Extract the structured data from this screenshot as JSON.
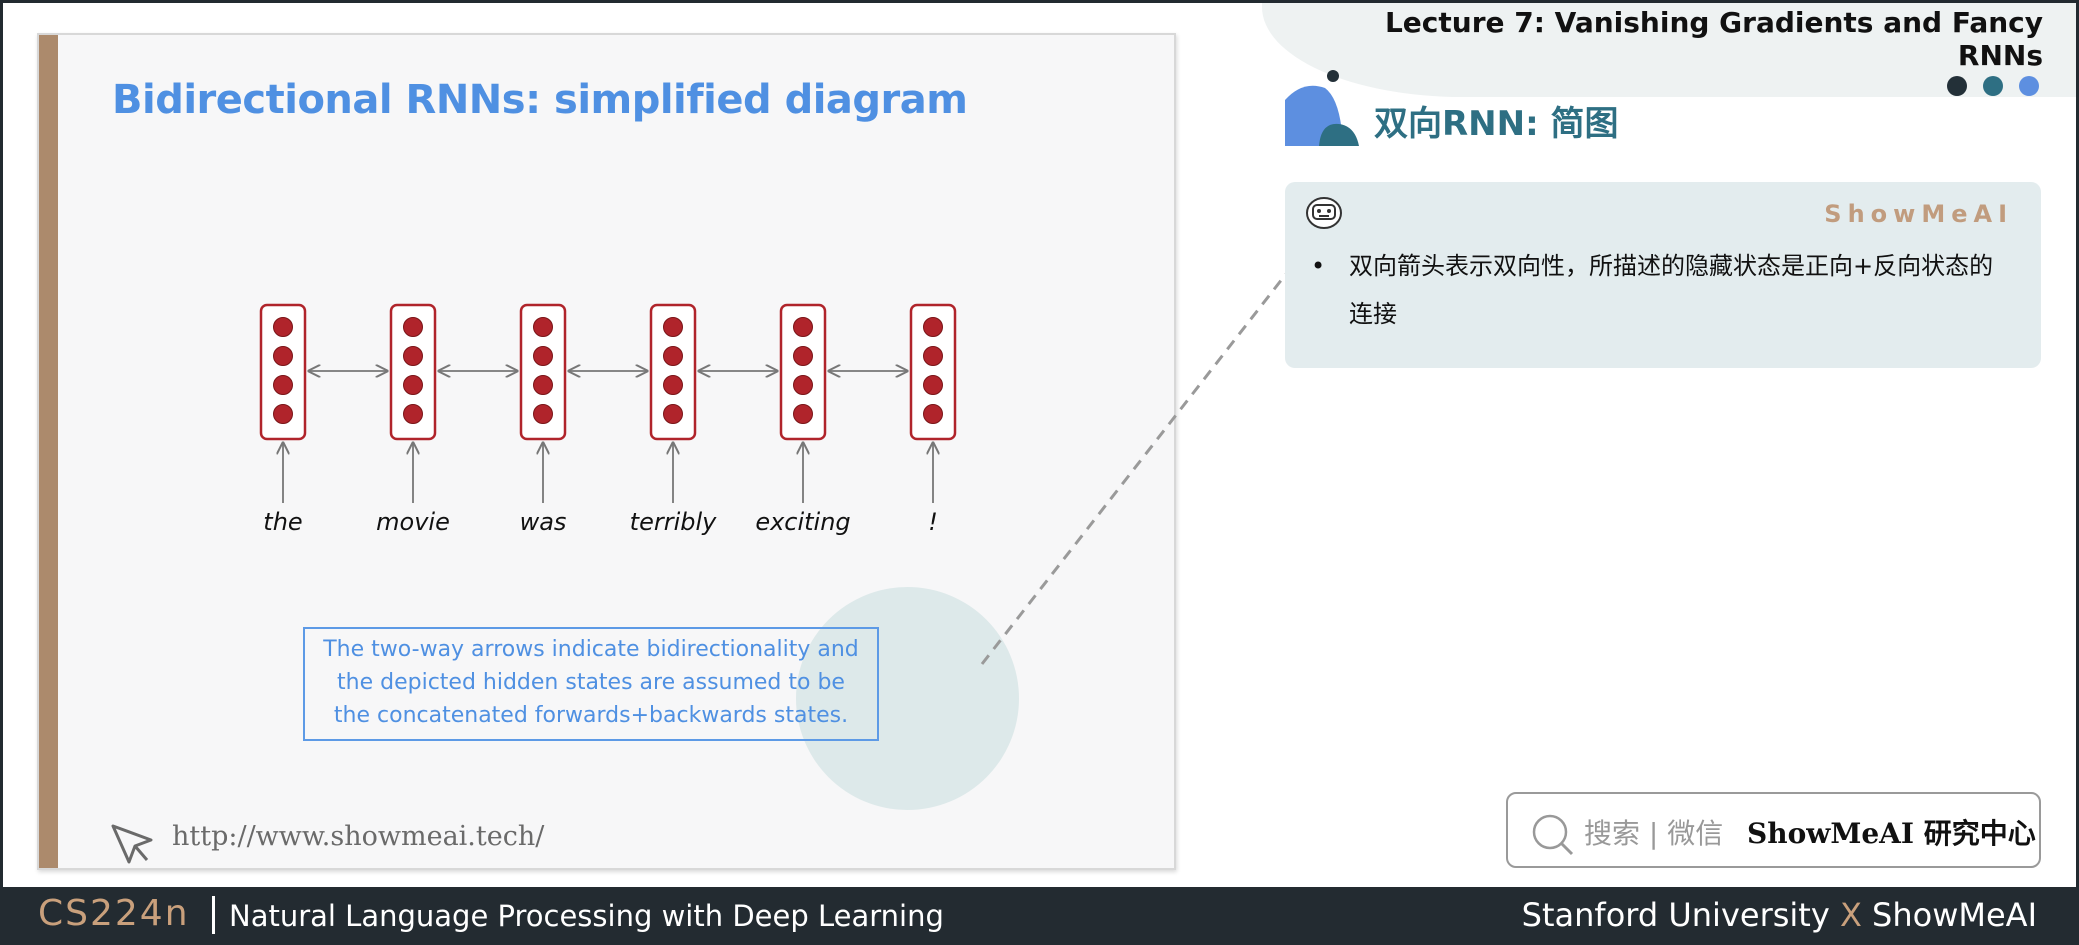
{
  "slide": {
    "title": "Bidirectional RNNs: simplified diagram",
    "words": [
      "the",
      "movie",
      "was",
      "terribly",
      "exciting",
      "!"
    ],
    "caption": [
      "The two-way arrows indicate bidirectionality and",
      "the depicted hidden states are assumed to be",
      "the concatenated forwards+backwards states."
    ],
    "url": "http://www.showmeai.tech/"
  },
  "header": {
    "lecture_title": "Lecture 7:  Vanishing Gradients and Fancy RNNs",
    "section_title": "双向RNN: 简图"
  },
  "note": {
    "brand": "ShowMeAI",
    "bullet_char": "•",
    "bullet_text": "双向箭头表示双向性，所描述的隐藏状态是正向+反向状态的连接"
  },
  "search": {
    "label": "搜索 | 微信",
    "brand": "ShowMeAI 研究中心"
  },
  "footer": {
    "course": "CS224n",
    "subtitle": "Natural Language Processing with Deep Learning",
    "right_part1": "Stanford University",
    "right_sep": "X",
    "right_part2": "ShowMeAI"
  },
  "colors": {
    "accent_blue": "#4f90e2",
    "brown": "#ac8a6c",
    "teal": "#2e6f83",
    "node_red": "#b0242b",
    "dot_colors": [
      "#233038",
      "#2e6f83",
      "#5d8fe0"
    ]
  }
}
